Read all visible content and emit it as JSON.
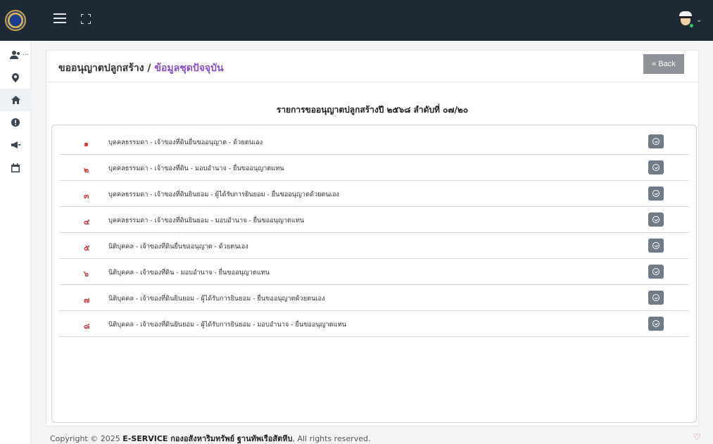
{
  "header": {
    "menu_icon": "hamburger-icon",
    "expand_icon": "expand-icon",
    "user_icon": "user-captain-icon"
  },
  "sidebar": {
    "items": [
      {
        "icon": "users-icon",
        "active": false
      },
      {
        "icon": "map-pin-icon",
        "active": false
      },
      {
        "icon": "home-icon",
        "active": true
      },
      {
        "icon": "info-icon",
        "active": false
      },
      {
        "icon": "megaphone-icon",
        "active": false
      },
      {
        "icon": "calendar-icon",
        "active": false
      }
    ]
  },
  "breadcrumb": {
    "parent": "ขออนุญาตปลูกสร้าง",
    "separator": "/",
    "current": "ข้อมูลชุดปัจจุบัน"
  },
  "back_button": "« Back",
  "list": {
    "title": "รายการขออนุญาตปลูกสร้างปี ๒๕๖๘ ลำดับที่ ๐๗/๒๐",
    "items": [
      {
        "num": "๑",
        "label": "บุคคลธรรมดา - เจ้าของที่ดินยื่นขออนุญาต - ด้วยตนเอง"
      },
      {
        "num": "๒",
        "label": "บุคคลธรรมดา - เจ้าของที่ดิน - มอบอำนาจ - ยื่นขออนุญาตแทน"
      },
      {
        "num": "๓",
        "label": "บุคคลธรรมดา - เจ้าของที่ดินยินยอม - ผู้ได้รับการยินยอม - ยื่นขออนุญาตด้วยตนเอง"
      },
      {
        "num": "๔",
        "label": "บุคคลธรรมดา - เจ้าของที่ดินยินยอม - มอบอำนาจ - ยื่นขออนุญาตแทน"
      },
      {
        "num": "๕",
        "label": "นิติบุคคล - เจ้าของที่ดินยื่นขออนุญาต - ด้วยตนเอง"
      },
      {
        "num": "๖",
        "label": "นิติบุคคล - เจ้าของที่ดิน - มอบอำนาจ - ยื่นขออนุญาตแทน"
      },
      {
        "num": "๗",
        "label": "นิติบุคคล - เจ้าของที่ดินยินยอม - ผู้ได้รับการยินยอม - ยื่นขออนุญาตด้วยตนเอง"
      },
      {
        "num": "๘",
        "label": "นิติบุคคล - เจ้าของที่ดินยินยอม - ผู้ได้รับการยินยอม - มอบอำนาจ - ยื่นขออนุญาตแทน"
      }
    ]
  },
  "footer": {
    "prefix": "Copyright © 2025 ",
    "org": "E-SERVICE กองอสังหาริมทรัพย์ ฐานทัพเรือสัตหีบ",
    "suffix": ", All rights reserved."
  },
  "colors": {
    "topbar": "#1d2935",
    "accent": "#8a4fc8",
    "number": "#d23a3a",
    "button": "#6f7b86"
  }
}
